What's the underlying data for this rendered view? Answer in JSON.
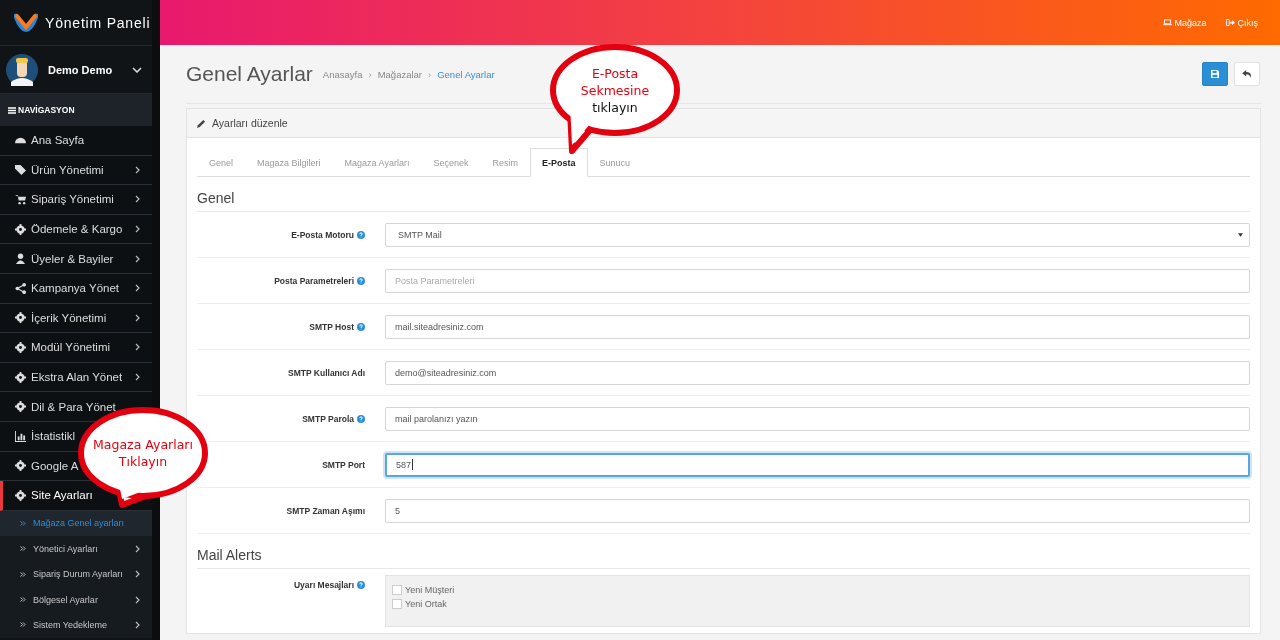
{
  "brand": {
    "title": "Yönetim Paneli"
  },
  "user": {
    "name": "Demo Demo"
  },
  "nav_header": "NAVİGASYON",
  "sidebar": {
    "items": [
      {
        "label": "Ana Sayfa",
        "has_submenu": false,
        "active": false
      },
      {
        "label": "Ürün Yönetimi",
        "has_submenu": true,
        "active": false
      },
      {
        "label": "Sipariş Yönetimi",
        "has_submenu": true,
        "active": false
      },
      {
        "label": "Ödemele & Kargo",
        "has_submenu": true,
        "active": false
      },
      {
        "label": "Üyeler & Bayiler",
        "has_submenu": true,
        "active": false
      },
      {
        "label": "Kampanya Yönet",
        "has_submenu": true,
        "active": false
      },
      {
        "label": "İçerik Yönetimi",
        "has_submenu": true,
        "active": false
      },
      {
        "label": "Modül Yönetimi",
        "has_submenu": true,
        "active": false
      },
      {
        "label": "Ekstra Alan Yönet",
        "has_submenu": true,
        "active": false
      },
      {
        "label": "Dil & Para Yönet",
        "has_submenu": false,
        "active": false
      },
      {
        "label": "İstatistikl",
        "active": false
      },
      {
        "label": "Google A",
        "active": false
      },
      {
        "label": "Site Ayarları",
        "has_submenu": false,
        "active": true,
        "children": [
          {
            "label": "Mağaza Genel ayarları",
            "has_submenu": false,
            "selected": true
          },
          {
            "label": "Yönetici Ayarları",
            "has_submenu": true,
            "selected": false
          },
          {
            "label": "Sipariş Durum Ayarları",
            "has_submenu": true,
            "selected": false
          },
          {
            "label": "Bölgesel Ayarlar",
            "has_submenu": true,
            "selected": false
          },
          {
            "label": "Sistem Yedekleme",
            "has_submenu": true,
            "selected": false
          }
        ]
      }
    ]
  },
  "topbar": {
    "links": [
      {
        "label": "Mağaza"
      },
      {
        "label": "Çıkış"
      }
    ]
  },
  "page": {
    "title": "Genel Ayarlar",
    "breadcrumb_separator": "›",
    "breadcrumb": [
      {
        "label": "Anasayfa",
        "current": false
      },
      {
        "label": "Mağazalar",
        "current": false
      },
      {
        "label": "Genel Ayarlar",
        "current": true
      }
    ]
  },
  "card": {
    "title": "Ayarları düzenle",
    "tabs": [
      {
        "label": "Genel",
        "selected": false
      },
      {
        "label": "Magaza Bilgileri",
        "selected": false
      },
      {
        "label": "Magaza Ayarları",
        "selected": false
      },
      {
        "label": "Seçenek",
        "selected": false
      },
      {
        "label": "Resim",
        "selected": false
      },
      {
        "label": "E-Posta",
        "selected": true
      },
      {
        "label": "Sunucu",
        "selected": false
      }
    ],
    "sections": [
      {
        "heading": "Genel",
        "rows": [
          {
            "kind": "select",
            "label": "E-Posta Motoru",
            "help": true,
            "value": "SMTP Mail",
            "focused": false
          },
          {
            "kind": "text",
            "label": "Posta Parametreleri",
            "help": true,
            "placeholder": "Posta Parametreleri",
            "focused": false
          },
          {
            "kind": "text",
            "label": "SMTP Host",
            "help": true,
            "value": "mail.siteadresiniz.com",
            "focused": false
          },
          {
            "kind": "text",
            "label": "SMTP Kullanıcı Adı",
            "help": false,
            "value": "demo@siteadresiniz.com",
            "focused": false
          },
          {
            "kind": "text",
            "label": "SMTP Parola",
            "help": true,
            "value": "mail parolanızı yazın",
            "focused": false
          },
          {
            "kind": "text",
            "label": "SMTP Port",
            "help": false,
            "value": "587",
            "focused": true
          },
          {
            "kind": "text",
            "label": "SMTP Zaman Aşımı",
            "help": false,
            "value": "5",
            "focused": false
          }
        ]
      },
      {
        "heading": "Mail Alerts",
        "rows": [
          {
            "kind": "checklist",
            "label": "Uyarı Mesajları",
            "help": true,
            "options": [
              {
                "label": "Yeni Müşteri",
                "checked": false
              },
              {
                "label": "Yeni Ortak",
                "checked": false
              }
            ]
          }
        ]
      }
    ]
  },
  "callouts": [
    {
      "lines": [
        {
          "text": "E-Posta",
          "color": "#e3000f"
        },
        {
          "text": "Sekmesine",
          "color": "#e3000f"
        },
        {
          "text": "tıklayın",
          "color": "#111111"
        }
      ]
    },
    {
      "lines": [
        {
          "text": "Magaza Ayarları",
          "color": "#e3000f"
        },
        {
          "text": "Tıklayın",
          "color": "#e3000f"
        }
      ]
    }
  ]
}
